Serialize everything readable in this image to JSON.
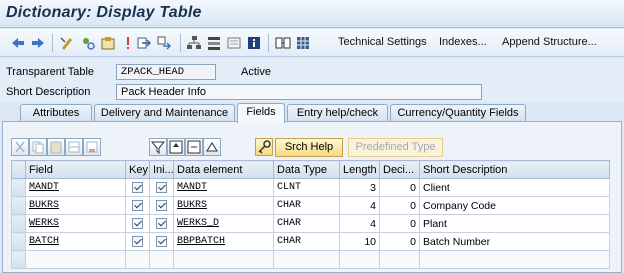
{
  "window": {
    "title": "Dictionary: Display Table"
  },
  "toolbar": {
    "icons": [
      "back-arrow-icon",
      "forward-arrow-icon",
      "display-change-icon",
      "other-object-icon",
      "check-icon",
      "activate-icon",
      "where-used-icon",
      "navigate-icon",
      "hierarchy-icon",
      "object-list-icon",
      "display-object-icon",
      "info-icon",
      "append-structure-icon",
      "table-contents-icon"
    ],
    "technical_settings": "Technical Settings",
    "indexes": "Indexes...",
    "append_structure": "Append Structure..."
  },
  "header": {
    "type_label": "Transparent Table",
    "table_name": "ZPACK_HEAD",
    "status": "Active",
    "short_desc_label": "Short Description",
    "short_desc_value": "Pack Header Info"
  },
  "tabs": [
    {
      "label": "Attributes",
      "active": false
    },
    {
      "label": "Delivery and Maintenance",
      "active": false
    },
    {
      "label": "Fields",
      "active": true
    },
    {
      "label": "Entry help/check",
      "active": false
    },
    {
      "label": "Currency/Quantity Fields",
      "active": false
    }
  ],
  "panel_toolbar": {
    "srch_help": "Srch Help",
    "predefined_type": "Predefined Type"
  },
  "table": {
    "columns": [
      "Field",
      "Key",
      "Ini...",
      "Data element",
      "Data Type",
      "Length",
      "Deci...",
      "Short Description"
    ],
    "rows": [
      {
        "field": "MANDT",
        "key": true,
        "initial": true,
        "data_element": "MANDT",
        "data_type": "CLNT",
        "length": "3",
        "decimals": "0",
        "desc": "Client"
      },
      {
        "field": "BUKRS",
        "key": true,
        "initial": true,
        "data_element": "BUKRS",
        "data_type": "CHAR",
        "length": "4",
        "decimals": "0",
        "desc": "Company Code"
      },
      {
        "field": "WERKS",
        "key": true,
        "initial": true,
        "data_element": "WERKS_D",
        "data_type": "CHAR",
        "length": "4",
        "decimals": "0",
        "desc": "Plant"
      },
      {
        "field": "BATCH",
        "key": true,
        "initial": true,
        "data_element": "BBPBATCH",
        "data_type": "CHAR",
        "length": "10",
        "decimals": "0",
        "desc": "Batch Number"
      }
    ]
  },
  "colors": {
    "accent": "#1d2f4f",
    "button_yellow": "#f6d97f"
  }
}
